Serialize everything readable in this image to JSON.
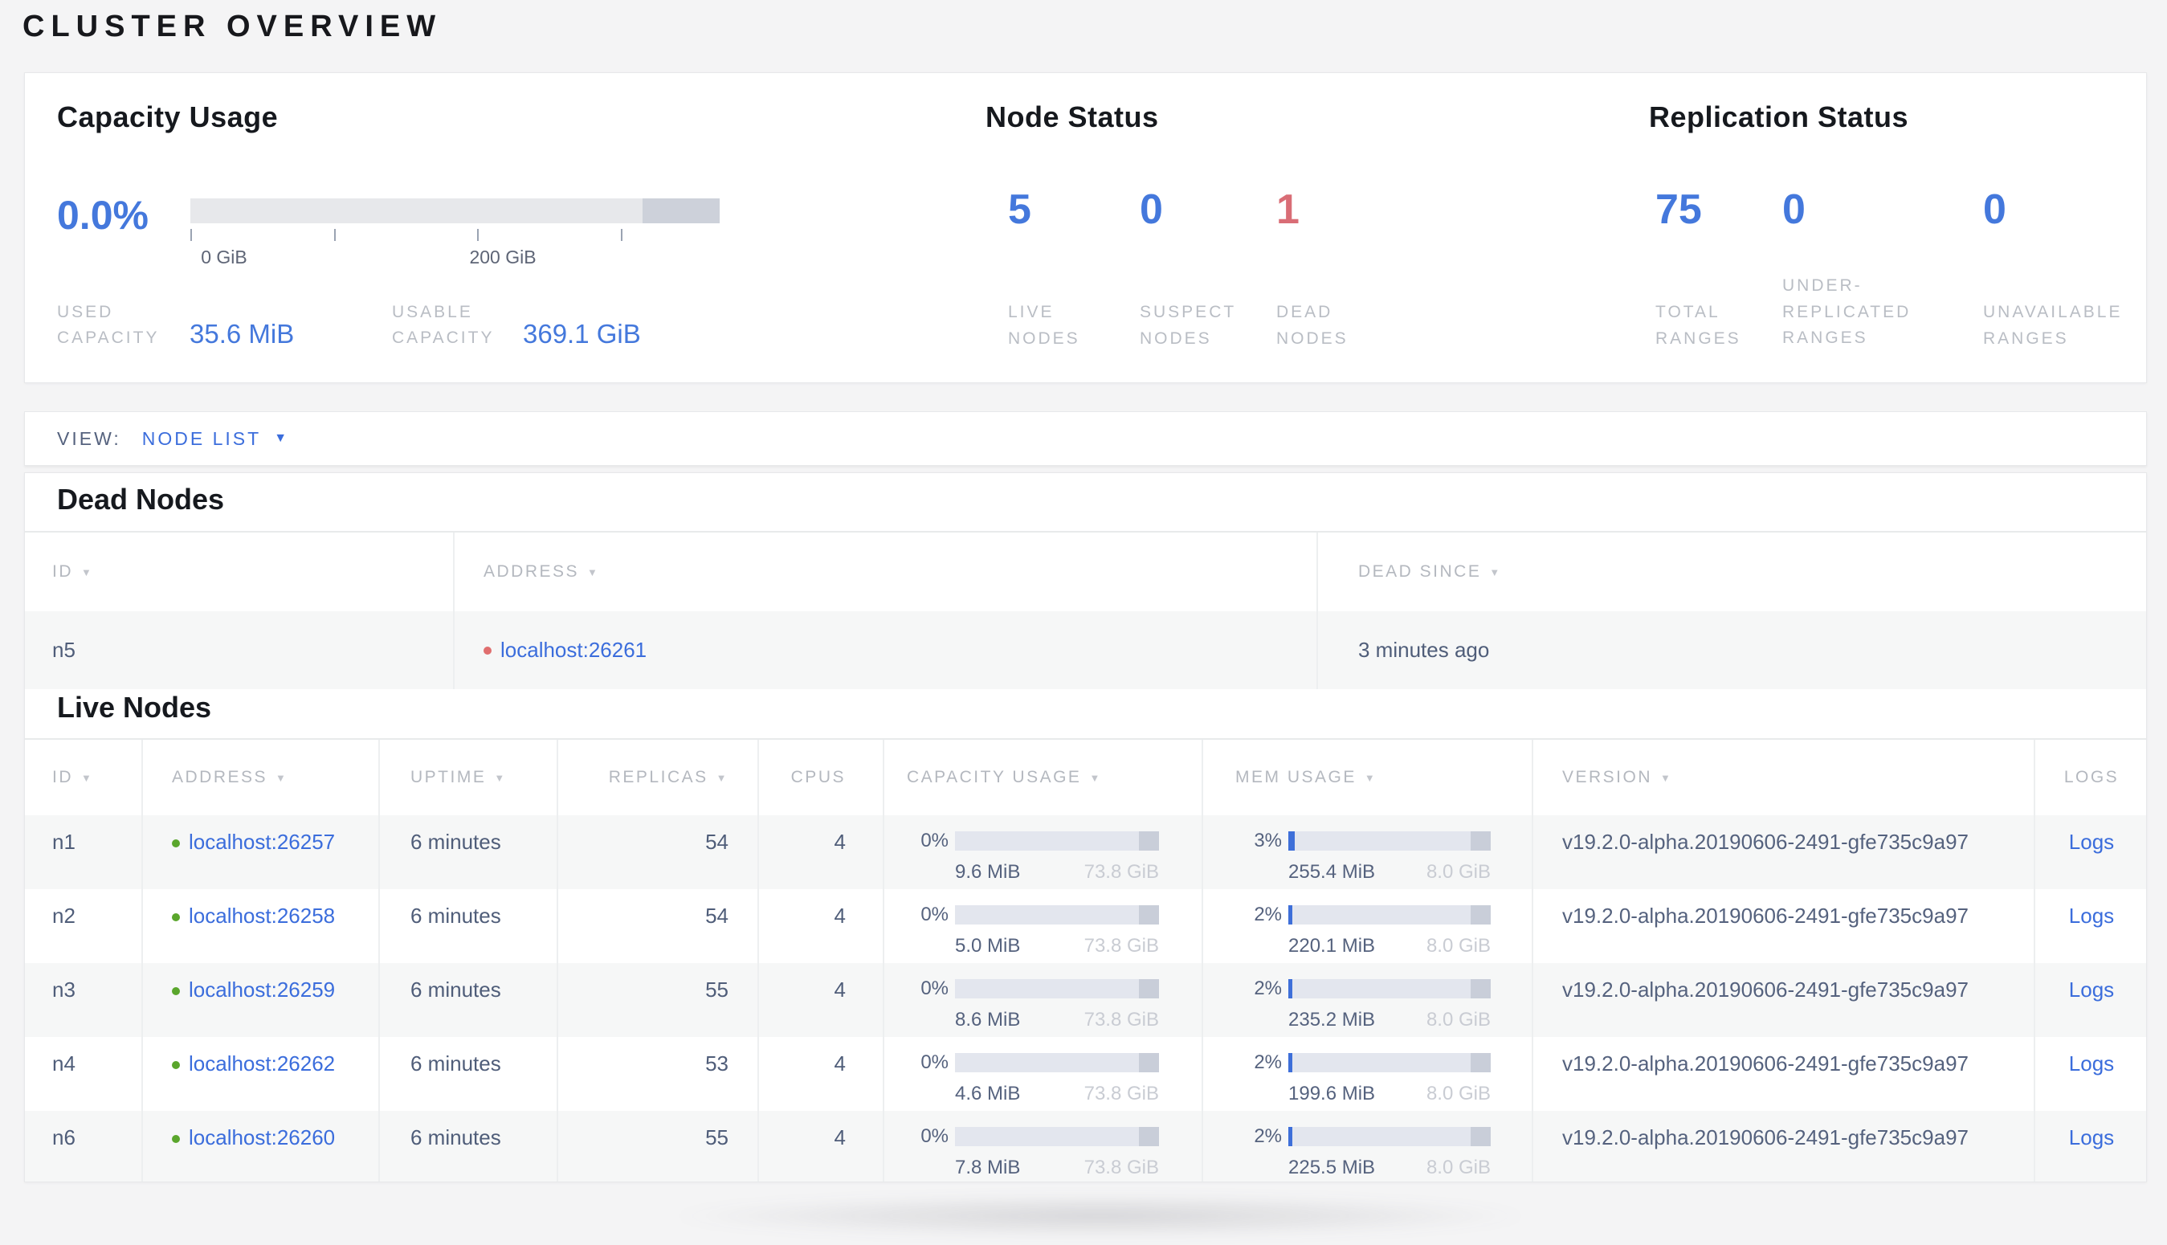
{
  "page": {
    "title": "CLUSTER OVERVIEW"
  },
  "summary": {
    "capacity": {
      "heading": "Capacity Usage",
      "percent": "0.0%",
      "tick_labels": [
        "0 GiB",
        "200 GiB"
      ],
      "used": {
        "label": "USED\nCAPACITY",
        "value": "35.6 MiB"
      },
      "usable": {
        "label": "USABLE\nCAPACITY",
        "value": "369.1 GiB"
      }
    },
    "node_status": {
      "heading": "Node Status",
      "stats": [
        {
          "value": "5",
          "label": "LIVE\nNODES"
        },
        {
          "value": "0",
          "label": "SUSPECT\nNODES"
        },
        {
          "value": "1",
          "label": "DEAD\nNODES"
        }
      ]
    },
    "replication": {
      "heading": "Replication Status",
      "stats": [
        {
          "value": "75",
          "label": "TOTAL\nRANGES"
        },
        {
          "value": "0",
          "label": "UNDER-\nREPLICATED\nRANGES"
        },
        {
          "value": "0",
          "label": "UNAVAILABLE\nRANGES"
        }
      ]
    }
  },
  "view_bar": {
    "label": "VIEW:",
    "selected": "NODE LIST",
    "caret": "▼"
  },
  "dead_nodes": {
    "heading": "Dead Nodes",
    "columns": [
      "ID",
      "ADDRESS",
      "DEAD SINCE"
    ],
    "sort_icon": "▼",
    "rows": [
      {
        "id": "n5",
        "address": "localhost:26261",
        "dead_since": "3 minutes ago"
      }
    ]
  },
  "live_nodes": {
    "heading": "Live Nodes",
    "columns": [
      "ID",
      "ADDRESS",
      "UPTIME",
      "REPLICAS",
      "CPUS",
      "CAPACITY USAGE",
      "MEM USAGE",
      "VERSION",
      "LOGS"
    ],
    "sort_icon": "▼",
    "rows": [
      {
        "id": "n1",
        "address": "localhost:26257",
        "uptime": "6 minutes",
        "replicas": "54",
        "cpus": "4",
        "cap_pct": "0%",
        "cap_pct_value": 0,
        "cap_used": "9.6 MiB",
        "cap_total": "73.8 GiB",
        "mem_pct": "3%",
        "mem_pct_value": 3,
        "mem_used": "255.4 MiB",
        "mem_total": "8.0 GiB",
        "version": "v19.2.0-alpha.20190606-2491-gfe735c9a97",
        "logs": "Logs"
      },
      {
        "id": "n2",
        "address": "localhost:26258",
        "uptime": "6 minutes",
        "replicas": "54",
        "cpus": "4",
        "cap_pct": "0%",
        "cap_pct_value": 0,
        "cap_used": "5.0 MiB",
        "cap_total": "73.8 GiB",
        "mem_pct": "2%",
        "mem_pct_value": 2,
        "mem_used": "220.1 MiB",
        "mem_total": "8.0 GiB",
        "version": "v19.2.0-alpha.20190606-2491-gfe735c9a97",
        "logs": "Logs"
      },
      {
        "id": "n3",
        "address": "localhost:26259",
        "uptime": "6 minutes",
        "replicas": "55",
        "cpus": "4",
        "cap_pct": "0%",
        "cap_pct_value": 0,
        "cap_used": "8.6 MiB",
        "cap_total": "73.8 GiB",
        "mem_pct": "2%",
        "mem_pct_value": 2,
        "mem_used": "235.2 MiB",
        "mem_total": "8.0 GiB",
        "version": "v19.2.0-alpha.20190606-2491-gfe735c9a97",
        "logs": "Logs"
      },
      {
        "id": "n4",
        "address": "localhost:26262",
        "uptime": "6 minutes",
        "replicas": "53",
        "cpus": "4",
        "cap_pct": "0%",
        "cap_pct_value": 0,
        "cap_used": "4.6 MiB",
        "cap_total": "73.8 GiB",
        "mem_pct": "2%",
        "mem_pct_value": 2,
        "mem_used": "199.6 MiB",
        "mem_total": "8.0 GiB",
        "version": "v19.2.0-alpha.20190606-2491-gfe735c9a97",
        "logs": "Logs"
      },
      {
        "id": "n6",
        "address": "localhost:26260",
        "uptime": "6 minutes",
        "replicas": "55",
        "cpus": "4",
        "cap_pct": "0%",
        "cap_pct_value": 0,
        "cap_used": "7.8 MiB",
        "cap_total": "73.8 GiB",
        "mem_pct": "2%",
        "mem_pct_value": 2,
        "mem_used": "225.5 MiB",
        "mem_total": "8.0 GiB",
        "version": "v19.2.0-alpha.20190606-2491-gfe735c9a97",
        "logs": "Logs"
      }
    ]
  },
  "colors": {
    "accent_blue": "#4478dc",
    "link_blue": "#3b6ddc",
    "danger_red": "#d96d76",
    "live_green": "#5aa62c",
    "dead_dot_red": "#e06e6e"
  }
}
